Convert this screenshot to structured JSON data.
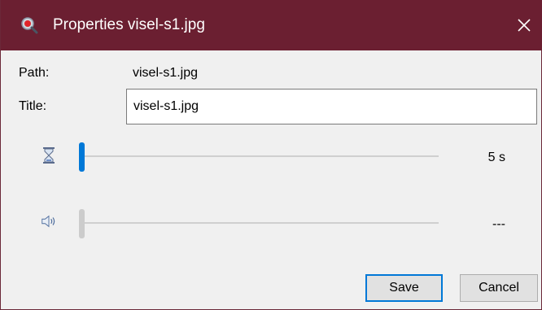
{
  "window": {
    "title": "Properties visel-s1.jpg",
    "titlebar_color": "#6b1f31",
    "close_glyph": "✕"
  },
  "fields": {
    "path_label": "Path:",
    "path_value": "visel-s1.jpg",
    "title_label": "Title:",
    "title_value": "visel-s1.jpg"
  },
  "duration": {
    "icon": "hourglass-icon",
    "value": "5 s",
    "slider_fraction": 0.0,
    "accent": "#0078d7"
  },
  "volume": {
    "icon": "speaker-icon",
    "value": "---",
    "slider_fraction": 0.0,
    "disabled": true
  },
  "buttons": {
    "save": "Save",
    "cancel": "Cancel"
  }
}
